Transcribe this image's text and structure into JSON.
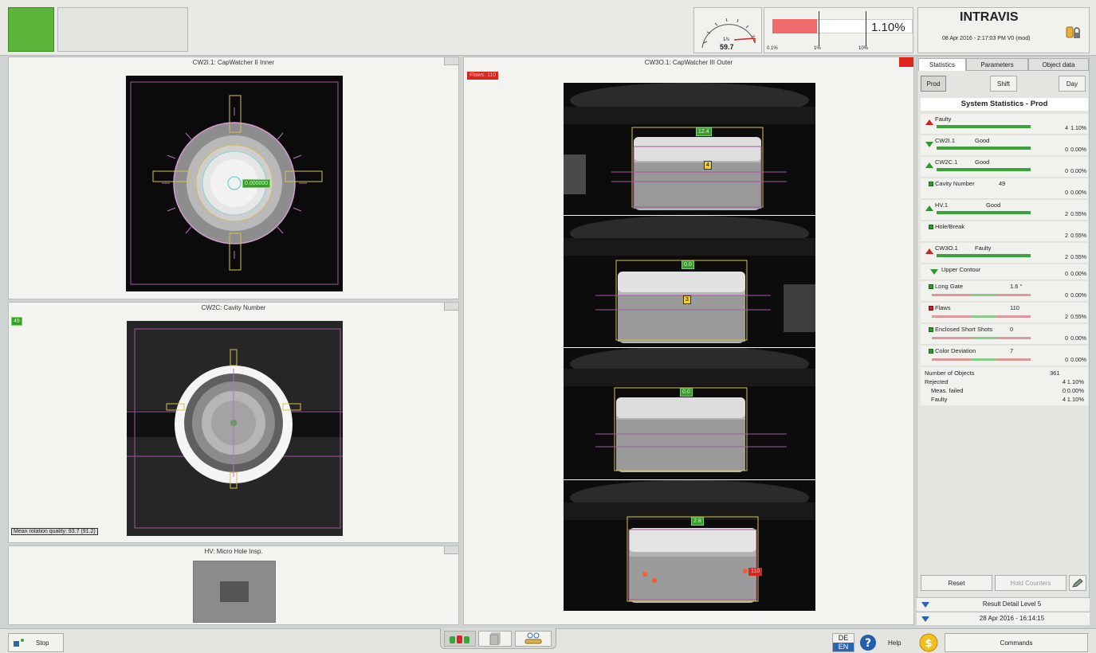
{
  "header": {
    "brand": "INTRAVIS",
    "datetime": "08 Apr 2016 - 2:17:03 PM  V0 (mod)",
    "gauge_unit": "1/s",
    "gauge_value": "59.7",
    "reject_rate": "1.10%",
    "reject_scale": [
      "0.1%",
      "1%",
      "10%"
    ],
    "reject_fraction": 0.32,
    "status_color": "#5bb33a"
  },
  "panels": {
    "inner_title": "CW2I.1: CapWatcher II Inner",
    "inner_tag": "0.000000",
    "cavity_title": "CW2C: Cavity Number",
    "cavity_tag": "49",
    "cavity_quality": "Mean rotation quality: 93.7 (91.2)",
    "hv_title": "HV: Micro Hole Insp.",
    "outer_title": "CW3O.1: CapWatcher III Outer",
    "outer_tag": "Flaws: 110",
    "outer_views": [
      {
        "top_tag": "12.4",
        "mid_tag": "4"
      },
      {
        "top_tag": "0.0",
        "mid_tag": "3"
      },
      {
        "top_tag": "0.0"
      },
      {
        "top_tag": "2.8",
        "right_tag": "110"
      }
    ]
  },
  "right": {
    "tabs": [
      "Statistics",
      "Parameters",
      "Object data"
    ],
    "period_buttons": [
      "Prod",
      "Shift",
      "Day"
    ],
    "stats_title": "System Statistics - Prod",
    "rows": [
      {
        "name": "Faulty",
        "value": "",
        "count": "4",
        "pct": "1.10%"
      },
      {
        "name": "CW2I.1",
        "value": "Good",
        "count": "0",
        "pct": "0.00%"
      },
      {
        "name": "CW2C.1",
        "value": "Good",
        "count": "0",
        "pct": "0.00%"
      },
      {
        "name": "Cavity Number",
        "value": "49",
        "count": "0",
        "pct": "0.00%"
      },
      {
        "name": "HV.1",
        "value": "Good",
        "count": "2",
        "pct": "0.55%"
      },
      {
        "name": "Hole/Break",
        "value": "",
        "count": "2",
        "pct": "0.55%"
      },
      {
        "name": "CW3O.1",
        "value": "Faulty",
        "count": "2",
        "pct": "0.55%"
      },
      {
        "name": "Upper Contour",
        "value": "",
        "count": "0",
        "pct": "0.00%"
      },
      {
        "name": "Long Gate",
        "value": "1.6 °",
        "count": "0",
        "pct": "0.00%"
      },
      {
        "name": "Flaws",
        "value": "110",
        "count": "2",
        "pct": "0.55%"
      },
      {
        "name": "Enclosed Short Shots",
        "value": "0",
        "count": "0",
        "pct": "0.00%"
      },
      {
        "name": "Color Deviation",
        "value": "7",
        "count": "0",
        "pct": "0.00%"
      }
    ],
    "summary": [
      {
        "label": "Number of Objects",
        "count": "361",
        "pct": ""
      },
      {
        "label": "Rejected",
        "count": "4",
        "pct": "1.10%"
      },
      {
        "label": "Meas. failed",
        "count": "0",
        "pct": "0.00%"
      },
      {
        "label": "Faulty",
        "count": "4",
        "pct": "1.10%"
      }
    ],
    "reset_label": "Reset",
    "hold_label": "Hold Counters",
    "detail_level": "Result Detail Level 5",
    "detail_date": "28 Apr 2016 - 16:14:15"
  },
  "footer": {
    "stop_label": "Stop",
    "lang_top": "DE",
    "lang_bottom": "EN",
    "help_label": "Help",
    "commands_label": "Commands"
  }
}
